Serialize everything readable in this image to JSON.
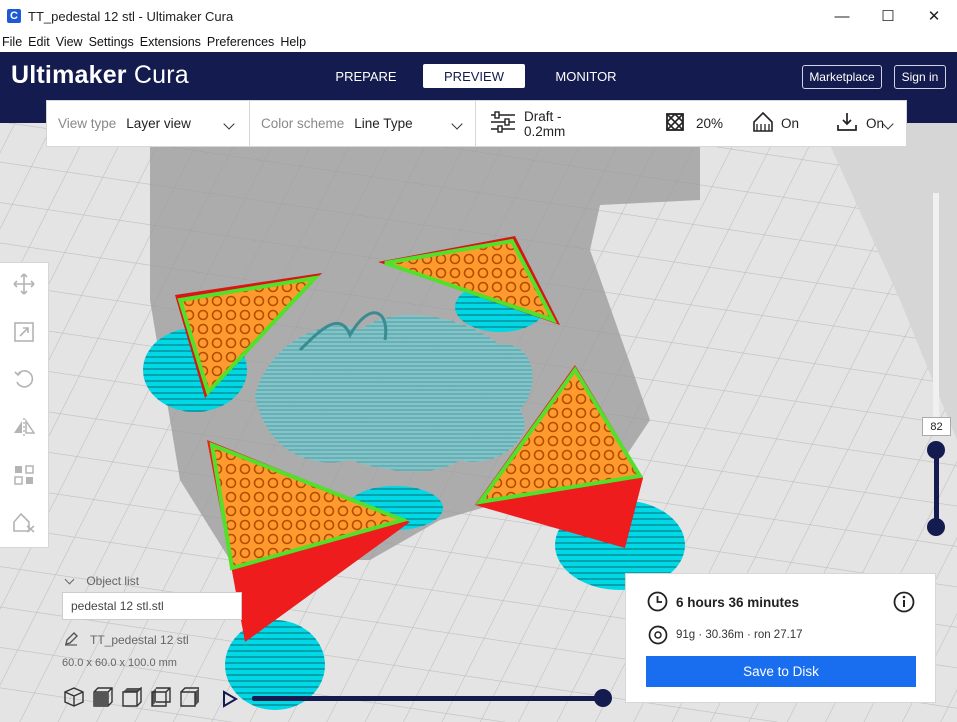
{
  "window": {
    "title": "TT_pedestal 12 stl - Ultimaker Cura",
    "app_icon": "C",
    "controls": {
      "minimize": "—",
      "maximize": "☐",
      "close": "✕"
    }
  },
  "menu": [
    "File",
    "Edit",
    "View",
    "Settings",
    "Extensions",
    "Preferences",
    "Help"
  ],
  "header": {
    "logo_bold": "Ultimaker",
    "logo_light": "Cura",
    "stages": [
      "PREPARE",
      "PREVIEW",
      "MONITOR"
    ],
    "active_stage": "PREVIEW",
    "marketplace": "Marketplace",
    "sign_in": "Sign in",
    "background_color": "#141b4e"
  },
  "toolbar": {
    "view_type_label": "View type",
    "view_type_value": "Layer view",
    "color_scheme_label": "Color scheme",
    "color_scheme_value": "Line Type",
    "profile": "Draft - 0.2mm",
    "infill": "20%",
    "support": "On",
    "adhesion": "On"
  },
  "left_tools": [
    "move-icon",
    "scale-icon",
    "rotate-icon",
    "mirror-icon",
    "per-model-settings-icon",
    "support-blocker-icon"
  ],
  "object_panel": {
    "header": "Object list",
    "selected_object": "pedestal 12 stl.stl",
    "name": "TT_pedestal 12 stl",
    "dimensions": "60.0 x 60.0 x 100.0 mm"
  },
  "layer_slider": {
    "current_layer": "82"
  },
  "print_info": {
    "time": "6 hours 36 minutes",
    "material": "91g · 30.36m · ron 27.17",
    "save_button": "Save to Disk"
  },
  "colors": {
    "accent": "#196ef0",
    "skin": "#ff9a2e",
    "wall": "#ff0000",
    "skirt": "#00e5ee",
    "infill_green": "#52e02a",
    "build_plate": "#e3e3e3"
  }
}
